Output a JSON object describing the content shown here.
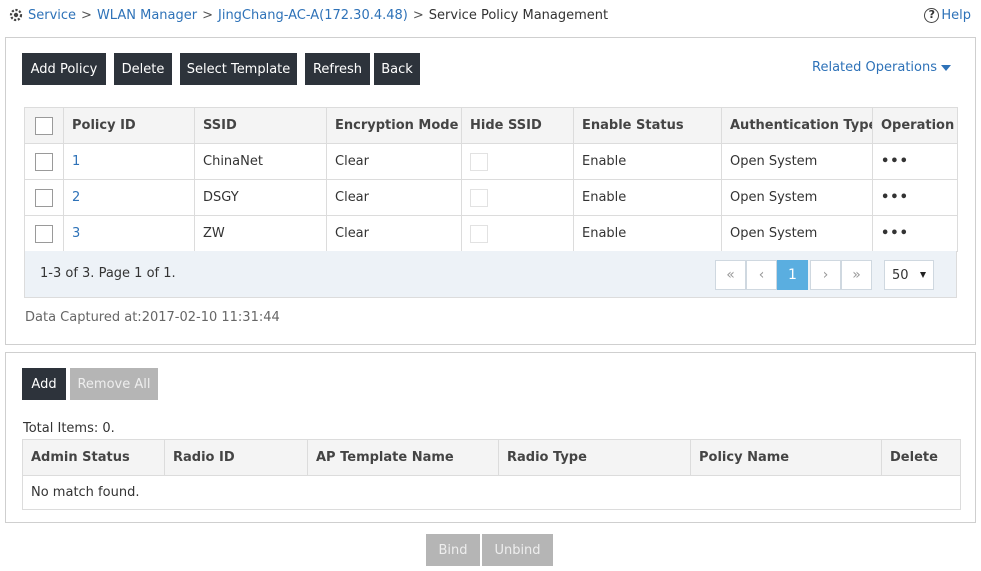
{
  "breadcrumb": {
    "items": [
      "Service",
      "WLAN Manager",
      "JingChang-AC-A(172.30.4.48)"
    ],
    "separator": ">",
    "current": "Service Policy Management"
  },
  "help": {
    "label": "Help",
    "glyph": "?"
  },
  "toolbar": {
    "add_policy": "Add Policy",
    "delete": "Delete",
    "select_template": "Select Template",
    "refresh": "Refresh",
    "back": "Back",
    "related_operations": "Related Operations"
  },
  "policy_table": {
    "columns": [
      "Policy ID",
      "SSID",
      "Encryption Mode",
      "Hide SSID",
      "Enable Status",
      "Authentication Type",
      "Operation"
    ],
    "rows": [
      {
        "policy_id": "1",
        "ssid": "ChinaNet",
        "encryption": "Clear",
        "hide_ssid": false,
        "enable_status": "Enable",
        "auth_type": "Open System",
        "operation": "•••"
      },
      {
        "policy_id": "2",
        "ssid": "DSGY",
        "encryption": "Clear",
        "hide_ssid": false,
        "enable_status": "Enable",
        "auth_type": "Open System",
        "operation": "•••"
      },
      {
        "policy_id": "3",
        "ssid": "ZW",
        "encryption": "Clear",
        "hide_ssid": false,
        "enable_status": "Enable",
        "auth_type": "Open System",
        "operation": "•••"
      }
    ]
  },
  "pager": {
    "info": "1-3 of 3. Page 1 of 1.",
    "first": "«",
    "prev": "‹",
    "current_page": "1",
    "next": "›",
    "last": "»",
    "page_size": "50"
  },
  "captured": "Data Captured at:2017-02-10 11:31:44",
  "binding": {
    "add": "Add",
    "remove_all": "Remove All",
    "total": "Total Items: 0.",
    "columns": [
      "Admin Status",
      "Radio ID",
      "AP Template Name",
      "Radio Type",
      "Policy Name",
      "Delete"
    ],
    "empty": "No match found."
  },
  "footer": {
    "bind": "Bind",
    "unbind": "Unbind"
  },
  "colors": {
    "accent": "#2e72b8",
    "dark_button": "#2d333b",
    "disabled_button": "#b5b5b5",
    "active_page": "#5aaee0"
  }
}
